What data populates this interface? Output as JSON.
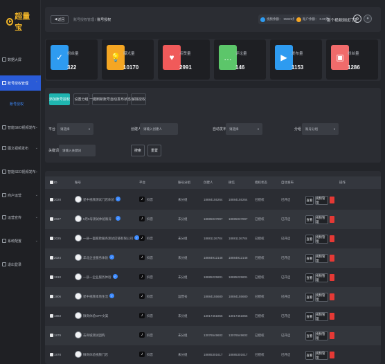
{
  "app": {
    "logo_text": "超量宝"
  },
  "sidebar": {
    "items": [
      {
        "label": "数据大屏",
        "icon": "monitor-icon"
      },
      {
        "label": "账号授权管理",
        "icon": "account-icon",
        "active": true
      },
      {
        "label": "智能SEO视频发布",
        "icon": "video-icon"
      },
      {
        "label": "图文视频发布",
        "icon": "image-icon"
      },
      {
        "label": "智能SEO视频发布",
        "icon": "seo-icon"
      },
      {
        "label": "商户运营",
        "icon": "shop-icon"
      },
      {
        "label": "运营宣传",
        "icon": "promo-icon"
      },
      {
        "label": "系统配置",
        "icon": "settings-icon"
      },
      {
        "label": "退出登录",
        "icon": "logout-icon"
      }
    ],
    "sub_item": "账号授权"
  },
  "topbar": {
    "back_label": "返回",
    "breadcrumb_parent": "账号授权管理",
    "breadcrumb_sep": "/",
    "breadcrumb_current": "账号授权",
    "balance1_label": "视频余额：",
    "balance1_value": "55925条",
    "balance2_label": "账户余额：",
    "balance2_value": "0.00元",
    "shop_name": "那个视频测试门店"
  },
  "stats": [
    {
      "label": "粉丝量",
      "value": "322",
      "color": "#2e9bf0",
      "icon": "✓"
    },
    {
      "label": "曝光量",
      "value": "10170",
      "color": "#f5a623",
      "icon": "💡"
    },
    {
      "label": "点赞量",
      "value": "2991",
      "color": "#f05a5a",
      "icon": "♥"
    },
    {
      "label": "评论量",
      "value": "146",
      "color": "#5cc66a",
      "icon": "…"
    },
    {
      "label": "发布量",
      "value": "1153",
      "color": "#2e9bf0",
      "icon": "▶"
    },
    {
      "label": "粉丝量",
      "value": "1286",
      "color": "#f06b6b",
      "icon": "▣"
    }
  ],
  "filters": {
    "tabs": [
      "添加账号授权",
      "设置分组",
      "一键刷新账号自动发布状态",
      "解除授权"
    ],
    "platform_label": "平台",
    "platform_value": "请选择",
    "creator_label": "创建人",
    "creator_placeholder": "请输入创建人",
    "auto_label": "自动发布",
    "auto_value": "请选择",
    "group_label": "分组",
    "group_value": "账号分组",
    "keyword_label": "关键词",
    "keyword_placeholder": "请输入关键词",
    "search_label": "搜索",
    "reset_label": "重置"
  },
  "table": {
    "headers": [
      "ID",
      "账号",
      "平台",
      "账号分组",
      "创建人",
      "微信",
      "授权状态",
      "自动发布",
      "操作"
    ],
    "action_edit": "查看",
    "action_video": "视频管理",
    "rows": [
      {
        "id": "2028",
        "name": "星中视频测试门店体验",
        "platform": "抖音",
        "group": "未分组",
        "creator": "18884155264",
        "wechat": "18884155264",
        "status": "已授权",
        "auto": "已开启",
        "verified": true
      },
      {
        "id": "2027",
        "name": "5月5号测试体验账号",
        "platform": "抖音",
        "group": "未分组",
        "creator": "18885037897",
        "wechat": "18885037897",
        "status": "已授权",
        "auto": "已开启",
        "verified": true
      },
      {
        "id": "2025",
        "name": "一县一面家政服务测试店铺有限公司",
        "platform": "抖音",
        "group": "未分组",
        "creator": "18881126784",
        "wechat": "18881126784",
        "status": "已授权",
        "auto": "已开启",
        "verified": true
      },
      {
        "id": "2024",
        "name": "华北企业服务体验",
        "platform": "抖音",
        "group": "未分组",
        "creator": "18884912148",
        "wechat": "18884912148",
        "status": "已授权",
        "auto": "已开启",
        "verified": true
      },
      {
        "id": "1910",
        "name": "一县一企业服务体验",
        "platform": "抖音",
        "group": "未分组",
        "creator": "18885225801",
        "wechat": "18885225801",
        "status": "已授权",
        "auto": "已开启",
        "verified": true
      },
      {
        "id": "1906",
        "name": "星中视频本地生活",
        "platform": "抖音",
        "group": "运营号",
        "creator": "18884155680",
        "wechat": "18884155680",
        "status": "已授权",
        "auto": "已开启",
        "verified": true
      },
      {
        "id": "1883",
        "name": "微商体验GPT文案",
        "platform": "抖音",
        "group": "未分组",
        "creator": "13017461865",
        "wechat": "13017461865",
        "status": "已授权",
        "auto": "已开启",
        "verified": false
      },
      {
        "id": "1879",
        "name": "去商城测试团购",
        "platform": "抖音",
        "group": "未分组",
        "creator": "13076549602",
        "wechat": "13076549602",
        "status": "已授权",
        "auto": "已开启",
        "verified": false
      },
      {
        "id": "1878",
        "name": "微商体验视频门店",
        "platform": "抖音",
        "group": "未分组",
        "creator": "18885301617",
        "wechat": "18885301617",
        "status": "已授权",
        "auto": "已开启",
        "verified": false
      }
    ]
  }
}
